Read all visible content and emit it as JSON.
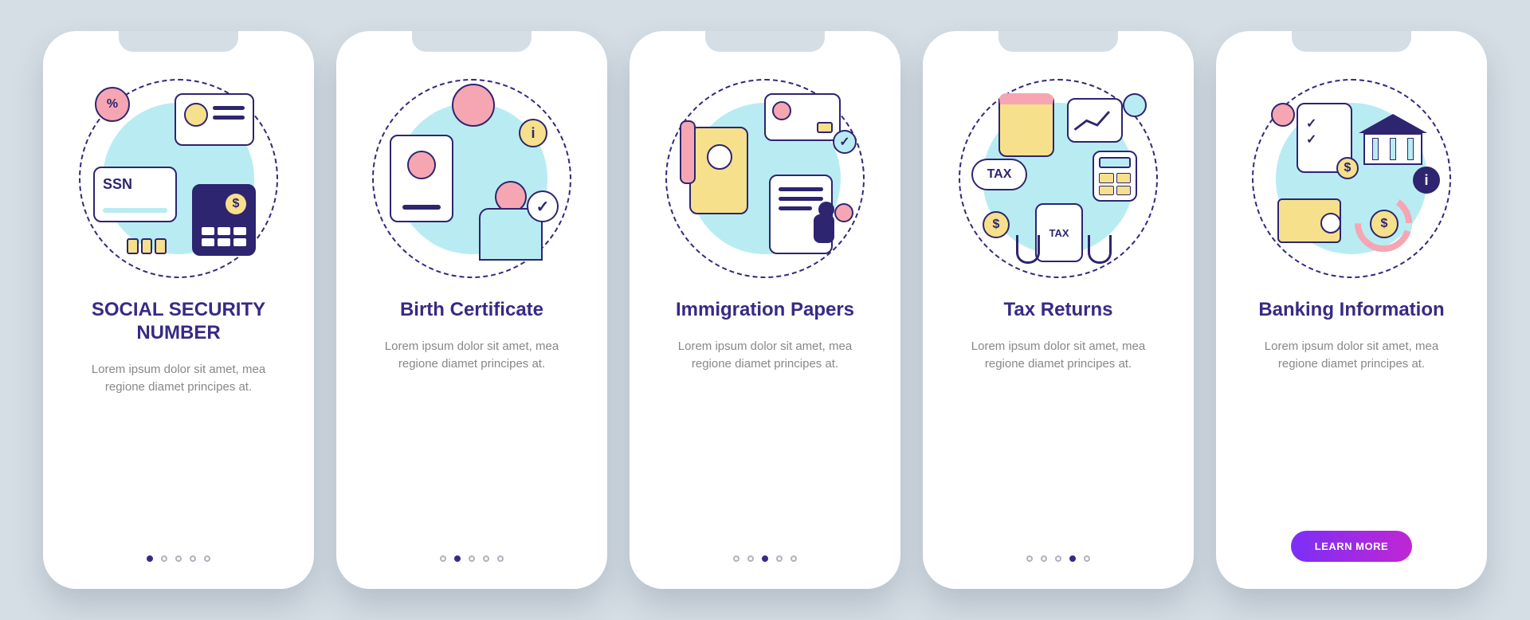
{
  "slides": [
    {
      "title": "SOCIAL SECURITY NUMBER",
      "titleCase": "upper",
      "desc": "Lorem ipsum dolor sit amet, mea regione diamet principes at.",
      "activeDot": 0,
      "hasCta": false
    },
    {
      "title": "Birth Certificate",
      "titleCase": "title",
      "desc": "Lorem ipsum dolor sit amet, mea regione diamet principes at.",
      "activeDot": 1,
      "hasCta": false
    },
    {
      "title": "Immigration Papers",
      "titleCase": "title",
      "desc": "Lorem ipsum dolor sit amet, mea regione diamet principes at.",
      "activeDot": 2,
      "hasCta": false
    },
    {
      "title": "Tax Returns",
      "titleCase": "title",
      "desc": "Lorem ipsum dolor sit amet, mea regione diamet principes at.",
      "activeDot": 3,
      "hasCta": false
    },
    {
      "title": "Banking Information",
      "titleCase": "title",
      "desc": "Lorem ipsum dolor sit amet, mea regione diamet principes at.",
      "activeDot": 4,
      "hasCta": true
    }
  ],
  "ctaLabel": "LEARN MORE",
  "dotCount": 5,
  "ssnLabel": "SSN",
  "taxLabel": "TAX",
  "colors": {
    "primary": "#372a86",
    "yellow": "#f7e08b",
    "pink": "#f6a6b2",
    "cyan": "#b8ecf2"
  }
}
